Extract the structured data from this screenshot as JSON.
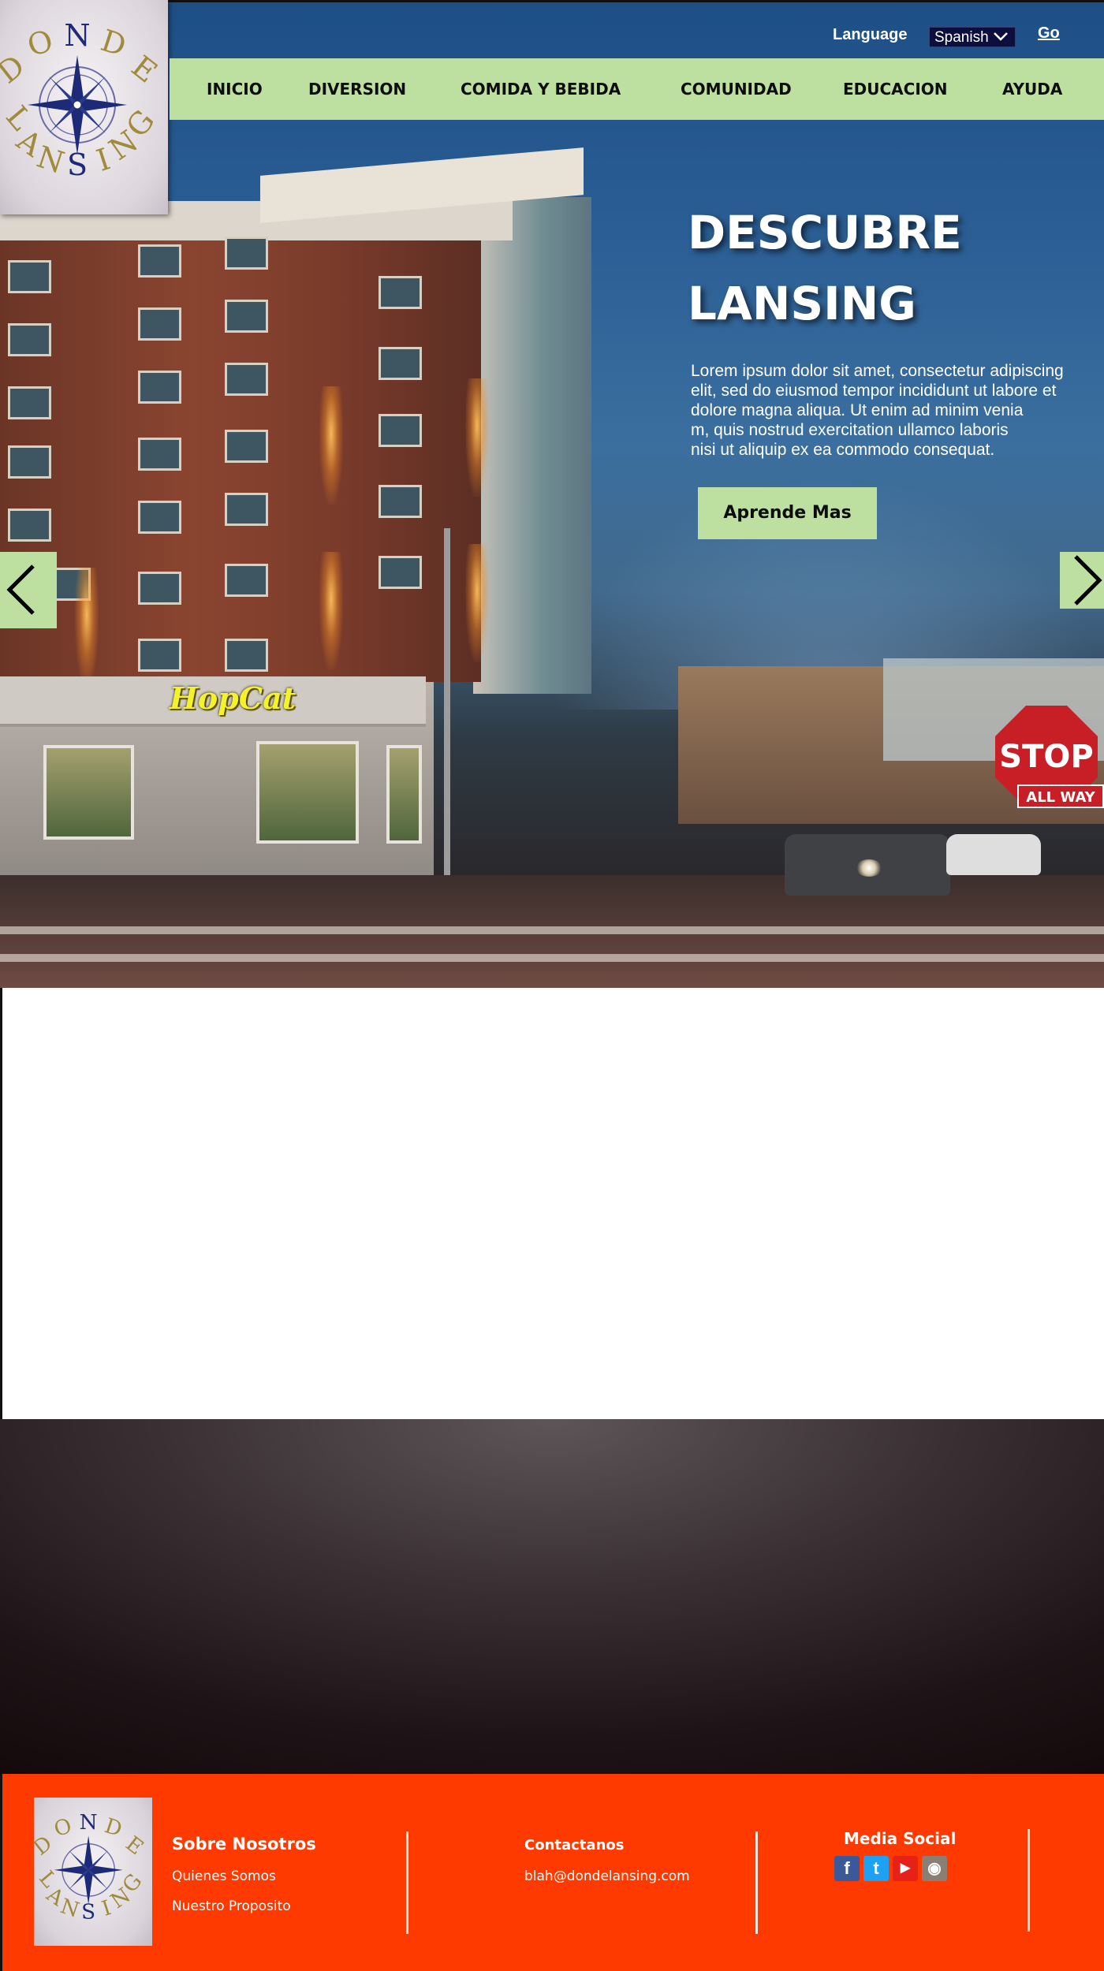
{
  "header": {
    "logo": {
      "alt": "DONDE LANSING",
      "letters_top": [
        "D",
        "O",
        "N",
        "D",
        "E"
      ],
      "letters_bottom": [
        "L",
        "A",
        "N",
        "S",
        "I",
        "N",
        "G"
      ]
    },
    "language_label": "Language",
    "language_selected": "Spanish",
    "go_label": "Go"
  },
  "nav": {
    "items": [
      {
        "label": "INICIO"
      },
      {
        "label": "DIVERSION"
      },
      {
        "label": "COMIDA Y BEBIDA"
      },
      {
        "label": "COMUNIDAD"
      },
      {
        "label": "EDUCACION"
      },
      {
        "label": "AYUDA"
      }
    ]
  },
  "hero": {
    "title_line1": "DESCUBRE",
    "title_line2": "LANSING",
    "body": "Lorem ipsum dolor sit amet, consectetur adipiscing\nelit, sed do eiusmod tempor incididunt ut labore et\n dolore magna aliqua. Ut enim ad minim venia\nm, quis nostrud exercitation ullamco laboris\nnisi ut aliquip ex ea commodo consequat.",
    "cta_label": "Aprende Mas",
    "prev_icon": "chevron-left-icon",
    "next_icon": "chevron-right-icon",
    "photo_signs": {
      "restaurant": "HopCat",
      "stop": "STOP",
      "all_way": "ALL WAY"
    }
  },
  "footer": {
    "about": {
      "heading": "Sobre Nosotros",
      "links": [
        "Quienes Somos",
        "Nuestro Proposito"
      ]
    },
    "contact": {
      "heading": "Contactanos",
      "email": "blah@dondelansing.com"
    },
    "social": {
      "heading": "Media Social",
      "icons": [
        {
          "name": "facebook-icon",
          "glyph": "f",
          "color": "#3b5998"
        },
        {
          "name": "twitter-icon",
          "glyph": "t",
          "color": "#1da1f2"
        },
        {
          "name": "youtube-icon",
          "glyph": "▶",
          "color": "#e62117"
        },
        {
          "name": "instagram-icon",
          "glyph": "◉",
          "color": "#8a7f74"
        }
      ]
    }
  },
  "colors": {
    "nav_bg": "#bde0a0",
    "footer_bg": "#ff3a00",
    "language_select_bg": "#0c0f3e",
    "logo_text_gold": "#a08a3c",
    "logo_compass_navy": "#1c2a78"
  }
}
